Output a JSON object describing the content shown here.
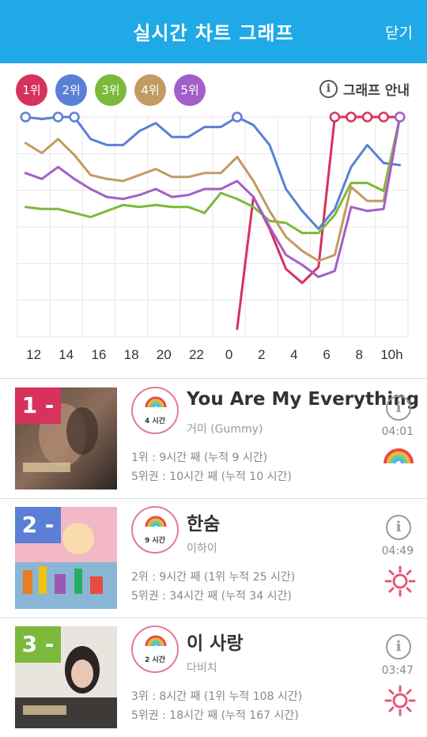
{
  "header": {
    "title": "실시간 차트 그래프",
    "close_label": "닫기"
  },
  "legend": [
    {
      "label": "1위",
      "color": "#d6325c"
    },
    {
      "label": "2위",
      "color": "#5b7fd6"
    },
    {
      "label": "3위",
      "color": "#7cb93a"
    },
    {
      "label": "4위",
      "color": "#c29b62"
    },
    {
      "label": "5위",
      "color": "#a35fc9"
    }
  ],
  "guide_label": "그래프 안내",
  "chart_data": {
    "type": "line",
    "x_labels": [
      "12",
      "14",
      "16",
      "18",
      "20",
      "22",
      "0",
      "2",
      "4",
      "6",
      "8",
      "10h"
    ],
    "x": [
      11,
      12,
      13,
      14,
      15,
      16,
      17,
      18,
      19,
      20,
      21,
      22,
      23,
      24,
      25,
      26,
      27,
      28,
      29,
      30,
      31,
      32,
      33,
      34
    ],
    "grid": true,
    "series": [
      {
        "name": "1위",
        "color": "#d6325c",
        "values": [
          null,
          null,
          null,
          null,
          null,
          null,
          null,
          null,
          null,
          null,
          null,
          null,
          null,
          106,
          40,
          56,
          76,
          83,
          75,
          0,
          0,
          0,
          0,
          0
        ]
      },
      {
        "name": "2위",
        "color": "#5b7fd6",
        "values": [
          0,
          1,
          0,
          0,
          11,
          14,
          14,
          7,
          3,
          10,
          10,
          5,
          5,
          0,
          4,
          14,
          36,
          47,
          56,
          46,
          25,
          14,
          23,
          24
        ]
      },
      {
        "name": "3위",
        "color": "#7cb93a",
        "values": [
          45,
          46,
          46,
          48,
          50,
          47,
          44,
          45,
          44,
          45,
          45,
          48,
          38,
          41,
          45,
          52,
          53,
          58,
          58,
          49,
          33,
          33,
          37,
          0
        ]
      },
      {
        "name": "4위",
        "color": "#c29b62",
        "values": [
          13,
          18,
          11,
          19,
          29,
          31,
          32,
          29,
          26,
          30,
          30,
          28,
          28,
          20,
          32,
          47,
          60,
          67,
          72,
          69,
          35,
          42,
          42,
          0
        ]
      },
      {
        "name": "5위",
        "color": "#a35fc9",
        "values": [
          28,
          31,
          25,
          31,
          36,
          40,
          41,
          39,
          36,
          40,
          39,
          36,
          36,
          32,
          40,
          55,
          69,
          74,
          80,
          77,
          45,
          47,
          46,
          0
        ]
      }
    ]
  },
  "entries": [
    {
      "rank": "1 -",
      "rank_color": "#d6325c",
      "badge_text": "4 시간",
      "title": "You Are My Everything",
      "artist": "거미 (Gummy)",
      "stat1": "1위 : 9시간 째 (누적 9 시간)",
      "stat2": "5위권 : 10시간 째 (누적 10 시간)",
      "duration": "04:01",
      "weather_icon": "rainbow-icon"
    },
    {
      "rank": "2 -",
      "rank_color": "#5b7fd6",
      "badge_text": "9 시간",
      "title": "한숨",
      "artist": "이하이",
      "stat1": "2위 : 9시간 째 (1위 누적 25 시간)",
      "stat2": "5위권 : 34시간 째 (누적 34 시간)",
      "duration": "04:49",
      "weather_icon": "sun-icon"
    },
    {
      "rank": "3 -",
      "rank_color": "#7cb93a",
      "badge_text": "2 시간",
      "title": "이 사랑",
      "artist": "다비치",
      "stat1": "3위 : 8시간 째 (1위 누적 108 시간)",
      "stat2": "5위권 : 18시간 째 (누적 167 시간)",
      "duration": "03:47",
      "weather_icon": "sun-icon"
    }
  ]
}
